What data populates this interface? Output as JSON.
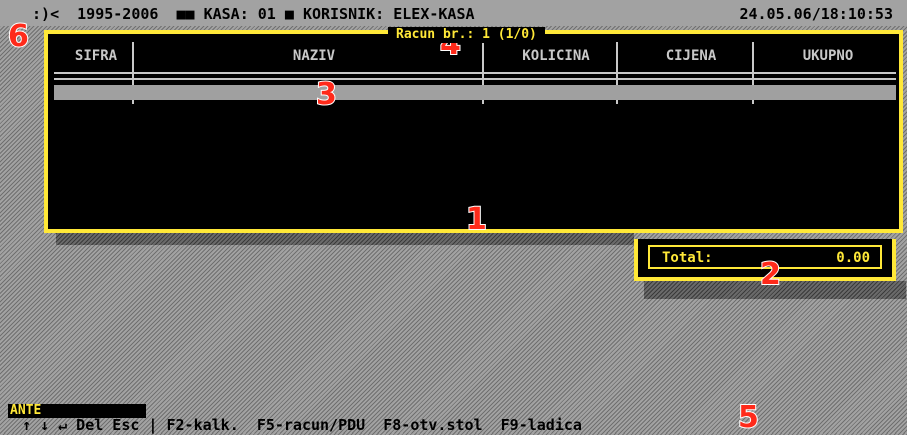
{
  "topbar": {
    "icon": ":)",
    "years": "<  1995-2006",
    "kasa": "KASA: 01",
    "korisnik": "KORISNIK: ELEX-KASA",
    "datetime": "24.05.06/18:10:53"
  },
  "receipt": {
    "title": "Racun br.: 1 (1/0)",
    "columns": [
      "SIFRA",
      "NAZIV",
      "KOLICINA",
      "CIJENA",
      "UKUPNO"
    ]
  },
  "total": {
    "label": "Total:",
    "value": "0.00"
  },
  "user": "ANTE",
  "hints": [
    "↑ ↓ ↵ Del Esc",
    "F2-kalk.",
    "F5-racun/PDU",
    "F8-otv.stol",
    "F9-ladica"
  ],
  "annotations": [
    "1",
    "2",
    "3",
    "4",
    "5",
    "6"
  ],
  "colors": {
    "accent": "#ffe838",
    "marker": "#ff2a1a",
    "panel": "#000000"
  }
}
